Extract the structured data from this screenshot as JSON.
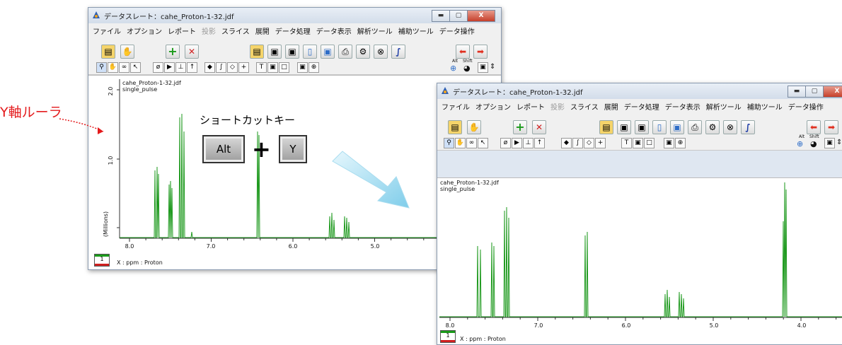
{
  "annotation": {
    "y_ruler_label": "Y軸ルーラ",
    "shortcut_caption": "ショートカットキー",
    "key_alt": "Alt",
    "plus": "+",
    "key_y": "Y"
  },
  "window": {
    "title": "データスレート：cahe_Proton-1-32.jdf",
    "menu": [
      {
        "label": "ファイル",
        "enabled": true
      },
      {
        "label": "オプション",
        "enabled": true
      },
      {
        "label": "レポート",
        "enabled": true
      },
      {
        "label": "投影",
        "enabled": false
      },
      {
        "label": "スライス",
        "enabled": true
      },
      {
        "label": "展開",
        "enabled": true
      },
      {
        "label": "データ処理",
        "enabled": true
      },
      {
        "label": "データ表示",
        "enabled": true
      },
      {
        "label": "解析ツール",
        "enabled": true
      },
      {
        "label": "補助ツール",
        "enabled": true
      },
      {
        "label": "データ操作",
        "enabled": true
      }
    ],
    "alt_label": "Alt",
    "shift_label": "Shift",
    "plot_file": "cahe_Proton-1-32.jdf",
    "plot_pulse": "single_pulse",
    "status_page": "1",
    "x_axis_label": "X : ppm : Proton"
  },
  "left_plot": {
    "y_ticks": [
      "2.0",
      "1.0"
    ],
    "y_unit": "(Millions)",
    "x_ticks": [
      "8.0",
      "7.0",
      "6.0",
      "5.0"
    ]
  },
  "right_plot": {
    "x_ticks": [
      "8.0",
      "7.0",
      "6.0",
      "5.0",
      "4.0"
    ]
  },
  "colors": {
    "spectrum": "#1f9a1f",
    "annotation_red": "#e41a1c",
    "arrow": "#8fd4f0"
  }
}
